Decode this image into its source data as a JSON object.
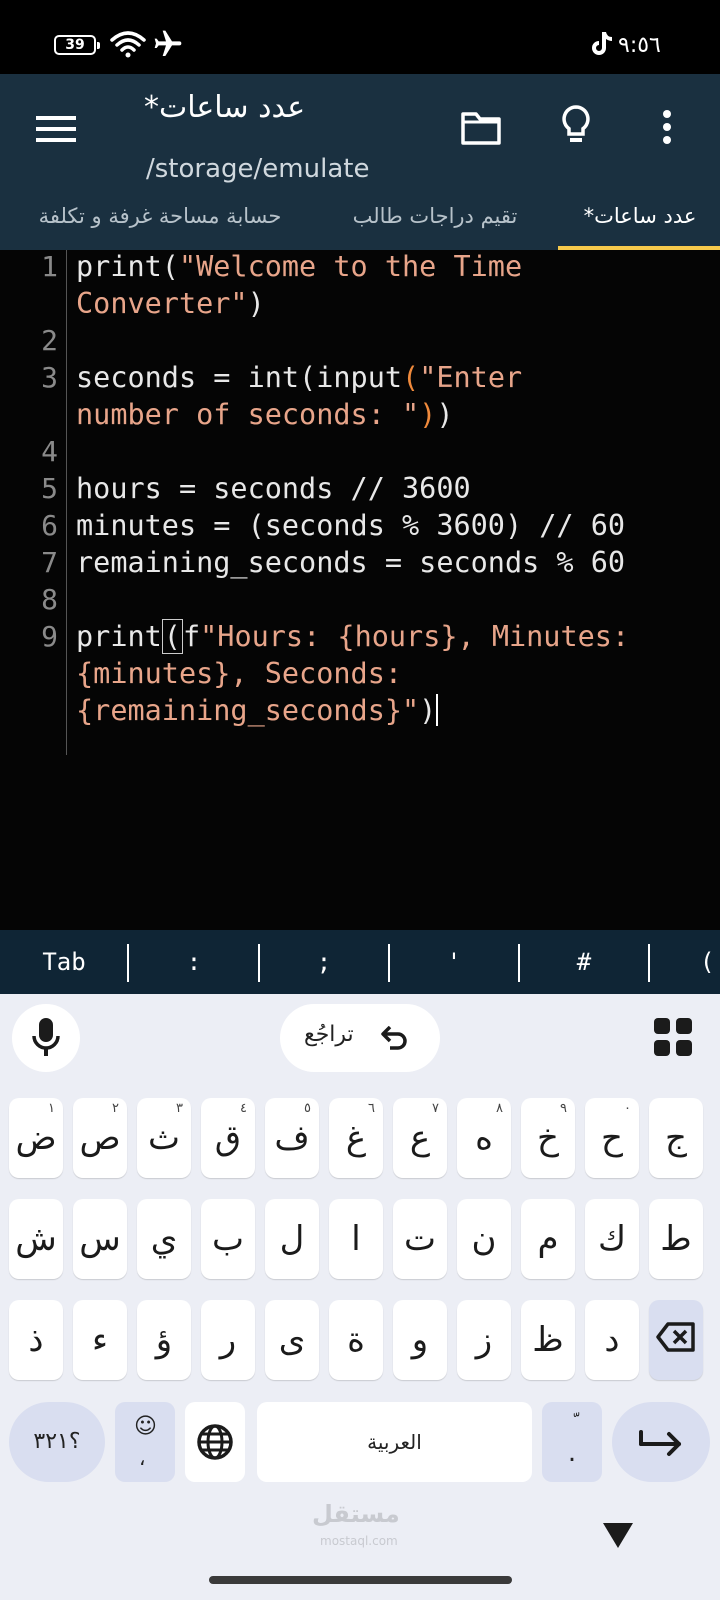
{
  "status_bar": {
    "battery": "39",
    "time": "٩:٥٦",
    "icons": [
      "battery-icon",
      "wifi-icon",
      "airplane-icon",
      "tiktok-icon"
    ]
  },
  "app_bar": {
    "title": "عدد ساعات*",
    "path": "/storage/emulate",
    "icons": [
      "menu-icon",
      "folder-icon",
      "bulb-icon",
      "more-icon"
    ]
  },
  "tabs": [
    {
      "label": "حسابة مساحة غرفة و تكلفة",
      "active": false
    },
    {
      "label": "تقيم دراجات طالب",
      "active": false
    },
    {
      "label": "عدد ساعات*",
      "active": true
    }
  ],
  "editor": {
    "line_numbers": [
      "1",
      "2",
      "3",
      "4",
      "5",
      "6",
      "7",
      "8",
      "9"
    ],
    "lines": {
      "l1a": "print(",
      "l1b": "\"Welcome to the Time",
      "l1c": "Converter\"",
      "l1d": ")",
      "l3a": "seconds = int(input",
      "l3b": "(",
      "l3c": "\"Enter",
      "l3d": "number of seconds: \"",
      "l3e": ")",
      "l3f": ")",
      "l5": "hours = seconds // 3600",
      "l6": "minutes = (seconds % 3600) // 60",
      "l7": "remaining_seconds = seconds % 60",
      "l9a": "print",
      "l9b": "(",
      "l9c": "f",
      "l9d": "\"Hours: {hours}, Minutes:",
      "l9e": "{minutes}, Seconds:",
      "l9f": "{remaining_seconds}\"",
      "l9g": ")"
    }
  },
  "symbol_bar": [
    "Tab",
    ":",
    ";",
    "'",
    "#",
    "("
  ],
  "keyboard": {
    "undo_label": "تراجُع",
    "row1": [
      {
        "k": "ض",
        "h": "١"
      },
      {
        "k": "ص",
        "h": "٢"
      },
      {
        "k": "ث",
        "h": "٣"
      },
      {
        "k": "ق",
        "h": "٤"
      },
      {
        "k": "ف",
        "h": "٥"
      },
      {
        "k": "غ",
        "h": "٦"
      },
      {
        "k": "ع",
        "h": "٧"
      },
      {
        "k": "ه",
        "h": "٨"
      },
      {
        "k": "خ",
        "h": "٩"
      },
      {
        "k": "ح",
        "h": "٠"
      },
      {
        "k": "ج",
        "h": ""
      }
    ],
    "row2": [
      "ش",
      "س",
      "ي",
      "ب",
      "ل",
      "ا",
      "ت",
      "ن",
      "م",
      "ك",
      "ط"
    ],
    "row3": [
      "ذ",
      "ء",
      "ؤ",
      "ر",
      "ى",
      "ة",
      "و",
      "ز",
      "ظ",
      "د"
    ],
    "num_key": "؟٣٢١",
    "emoji_top": "☺",
    "emoji_bottom": "،",
    "space_label": "العربية",
    "dot_top": "ّ",
    "dot_bottom": "."
  },
  "watermark": {
    "main": "مستقل",
    "sub": "mostaql.com"
  }
}
